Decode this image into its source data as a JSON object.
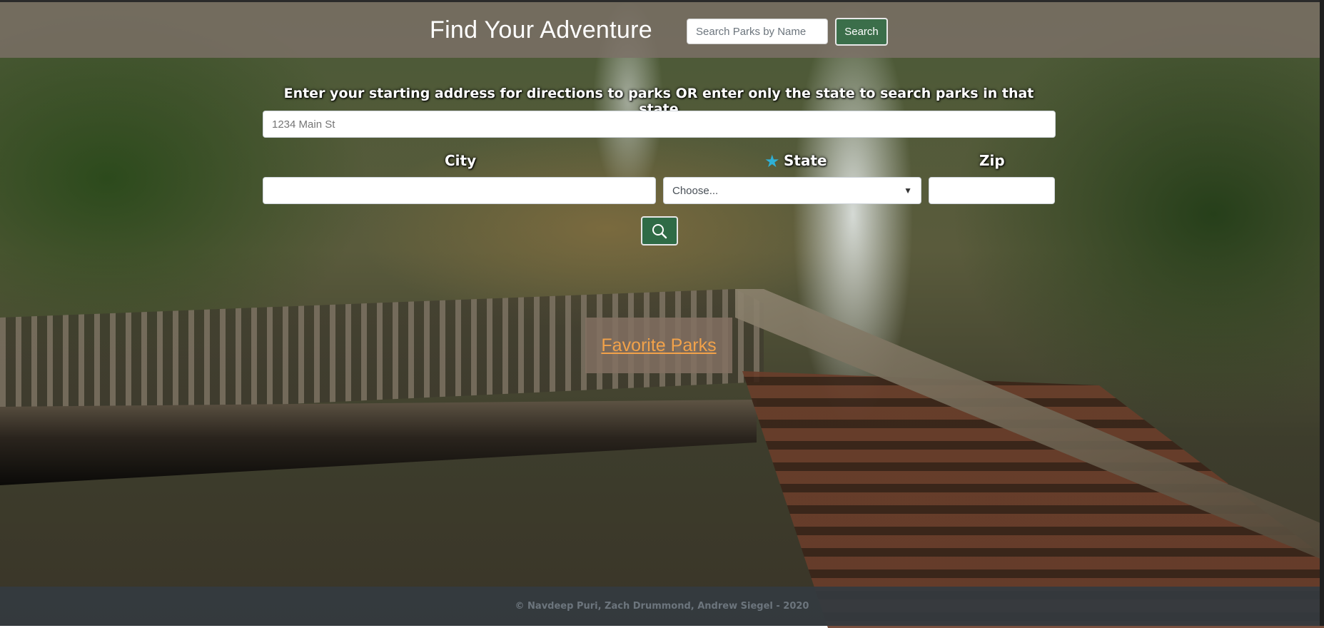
{
  "header": {
    "title": "Find Your Adventure",
    "name_search_placeholder": "Search Parks by Name",
    "search_button": "Search"
  },
  "form": {
    "prompt": "Enter your starting address for directions to parks OR enter only the state to search parks in that state",
    "address_placeholder": "1234 Main St",
    "city_label": "City",
    "state_label": "State",
    "zip_label": "Zip",
    "state_selected": "Choose...",
    "required_marker_icon": "star-icon",
    "submit_icon": "search-icon"
  },
  "favorites": {
    "label": "Favorite Parks"
  },
  "footer": {
    "text": "© Navdeep Puri, Zach Drummond, Andrew Siegel - 2020"
  },
  "colors": {
    "header_bg": "#7c7068",
    "button_green": "#3b6e4a",
    "favorites_link": "#f2a24a",
    "required_star": "#2fb0d6",
    "footer_bg": "#343a40"
  }
}
